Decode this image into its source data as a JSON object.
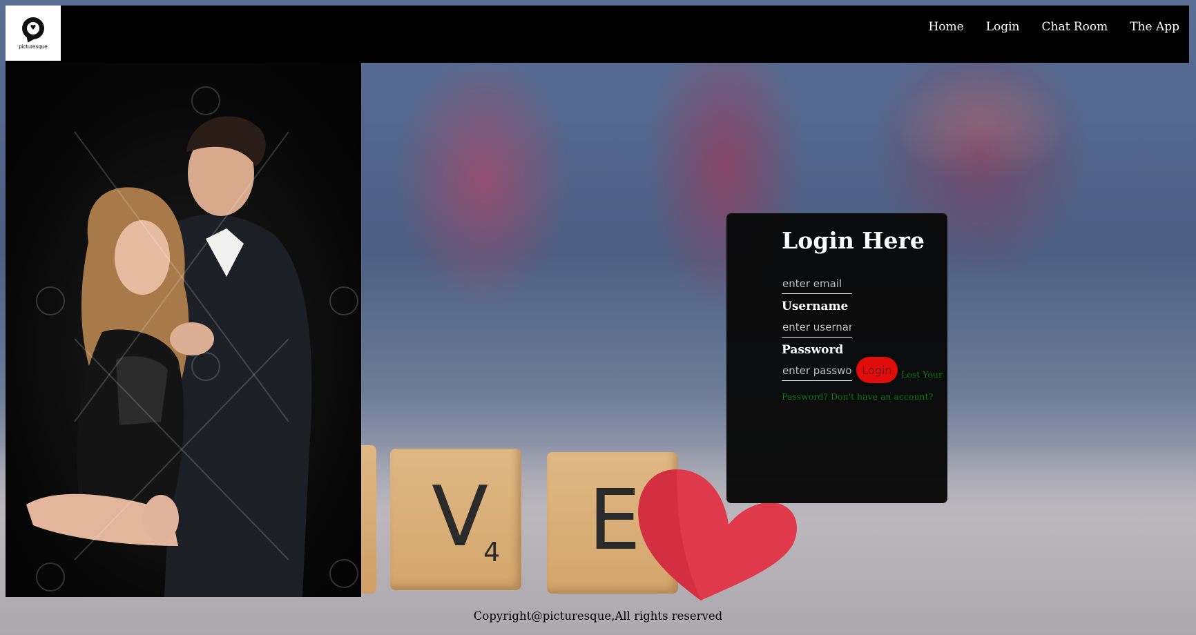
{
  "header": {
    "logo": {
      "name": "picturesque",
      "tagline": ""
    },
    "nav": [
      {
        "label": "Home"
      },
      {
        "label": "Login"
      },
      {
        "label": "Chat Room"
      },
      {
        "label": "The App"
      }
    ]
  },
  "hero": {
    "tiles": [
      {
        "letter": "V",
        "score": "4"
      },
      {
        "letter": "E",
        "score": ""
      }
    ]
  },
  "login_form": {
    "title": "Login Here",
    "email_placeholder": "enter email",
    "username_label": "Username",
    "username_placeholder": "enter username",
    "password_label": "Password",
    "password_placeholder": "enter password",
    "submit_label": "Login",
    "lost_password_link": "Lost Your Password?",
    "signup_link": "Don't have an account?"
  },
  "footer": {
    "copyright": "Copyright@picturesque,All rights reserved"
  },
  "colors": {
    "header_bg": "#000000",
    "card_bg": "#080808",
    "button_bg": "#e10d0d",
    "link_color": "#0f7a0f"
  }
}
